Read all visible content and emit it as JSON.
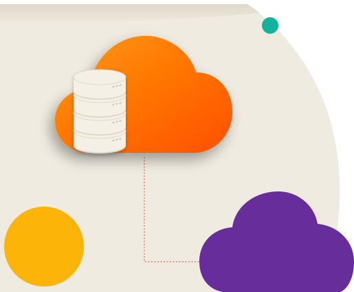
{
  "illustration": {
    "subject": "cloud-database",
    "colors": {
      "background_blob": "#f0ebe0",
      "top_band": "#e4dfd2",
      "orange_cloud_light": "#ff9a0a",
      "orange_cloud_dark": "#ff4f00",
      "database_disk": "#f4f0e6",
      "database_disk_edge": "#e0d9c8",
      "database_led": "#cfc7b4",
      "connector_line": "#e0682f",
      "purple_cloud": "#672d9b",
      "yellow_circle": "#fdb409",
      "teal_dot": "#12b39a"
    },
    "icons": [
      "cloud-icon",
      "database-icon",
      "cloud-icon",
      "circle",
      "dot"
    ]
  }
}
